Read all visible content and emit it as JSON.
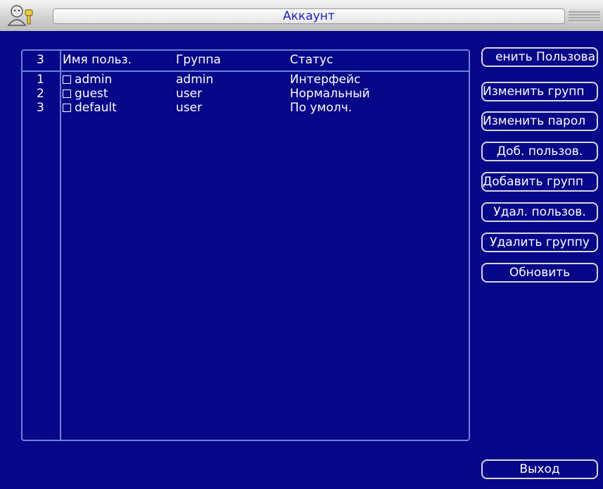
{
  "window": {
    "title": "Аккаунт",
    "logo_icon": "users-key-icon"
  },
  "table": {
    "header": {
      "count": "3",
      "name": "Имя польз.",
      "group": "Группа",
      "status": "Статус"
    },
    "rows": [
      {
        "num": "1",
        "name": "admin",
        "group": "admin",
        "status": "Интерфейс"
      },
      {
        "num": "2",
        "name": "guest",
        "group": "user",
        "status": "Нормальный"
      },
      {
        "num": "3",
        "name": "default",
        "group": "user",
        "status": "По умолч."
      }
    ]
  },
  "buttons": {
    "modify_user": "енить Пользова",
    "modify_group": "Изменить групп",
    "modify_password": "Изменить парол",
    "add_user": "Доб. пользов.",
    "add_group": "Добавить групп",
    "delete_user": "Удал. пользов.",
    "delete_group": "Удалить группу",
    "refresh": "Обновить",
    "exit": "Выход"
  },
  "colors": {
    "background": "#07078a",
    "border": "#6a84d6",
    "title_text": "#1a1ad0"
  }
}
